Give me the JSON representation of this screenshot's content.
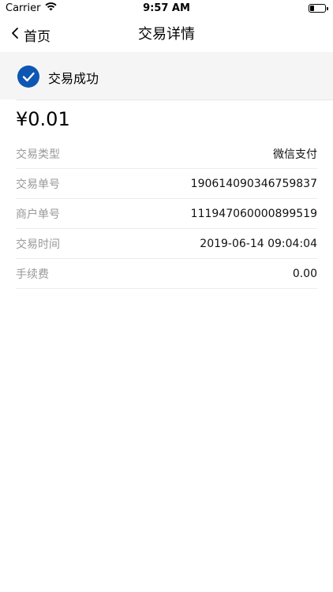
{
  "status_bar": {
    "carrier": "Carrier",
    "time": "9:57 AM",
    "wifi_icon": "wifi-icon",
    "battery_icon": "battery-icon",
    "battery_level": 0.3
  },
  "nav": {
    "back_label": "首页",
    "back_icon": "chevron-left-icon",
    "title": "交易详情"
  },
  "banner": {
    "status_text": "交易成功",
    "icon": "checkmark-circle-icon",
    "icon_color": "#0e56b3"
  },
  "amount": "¥0.01",
  "details": [
    {
      "label": "交易类型",
      "value": "微信支付"
    },
    {
      "label": "交易单号",
      "value": "190614090346759837"
    },
    {
      "label": "商户单号",
      "value": "111947060000899519"
    },
    {
      "label": "交易时间",
      "value": "2019-06-14 09:04:04"
    },
    {
      "label": "手续费",
      "value": "0.00"
    }
  ]
}
